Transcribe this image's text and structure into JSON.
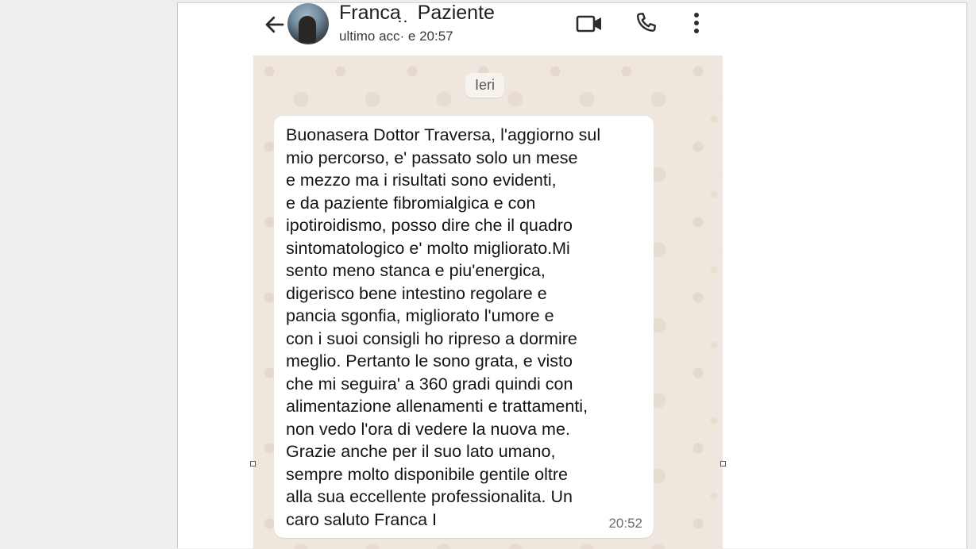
{
  "header": {
    "contact_name": "Franca  ̣             ̣ Paziente",
    "last_seen": "ultimo acc·            e 20:57"
  },
  "chat": {
    "date_separator": "Ieri",
    "message": {
      "text": "Buonasera Dottor Traversa, l'aggiorno sul\nmio percorso, e' passato solo un mese\ne mezzo ma i risultati sono evidenti,\ne da paziente fibromialgica e con\nipotiroidismo, posso dire che il quadro\nsintomatologico e' molto migliorato.Mi\nsento meno stanca e piu'energica,\ndigerisco bene intestino regolare e\npancia sgonfia, migliorato l'umore e\ncon i suoi consigli ho ripreso a dormire\nmeglio. Pertanto le sono grata, e visto\nche mi seguira' a 360 gradi quindi con\nalimentazione allenamenti e trattamenti,\nnon vedo l'ora di vedere la nuova me.\nGrazie anche per il suo lato umano,\nsempre molto disponibile  gentile oltre\nalla sua eccellente professionalita. Un\ncaro saluto Franca I",
      "time": "20:52"
    }
  },
  "icons": {
    "back": "arrow-left-icon",
    "video": "video-camera-icon",
    "call": "phone-icon",
    "menu": "more-vertical-icon"
  },
  "colors": {
    "chat_background": "#efe7dd",
    "bubble": "#ffffff",
    "page_background": "#eeeeee"
  }
}
